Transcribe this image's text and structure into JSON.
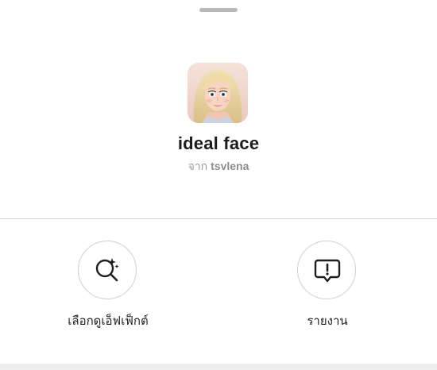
{
  "effect": {
    "name": "ideal face",
    "by_prefix": "จาก",
    "author": "tsvlena"
  },
  "actions": [
    {
      "label": "เลือกดูเอ็ฟเฟ็กต์",
      "icon": "search-sparkle-icon"
    },
    {
      "label": "รายงาน",
      "icon": "report-icon"
    }
  ],
  "colors": {
    "title": "#1b1b1b",
    "subtext": "#9a9a9a",
    "divider": "#d6d6d6",
    "circle_border": "#cfcfcf"
  }
}
